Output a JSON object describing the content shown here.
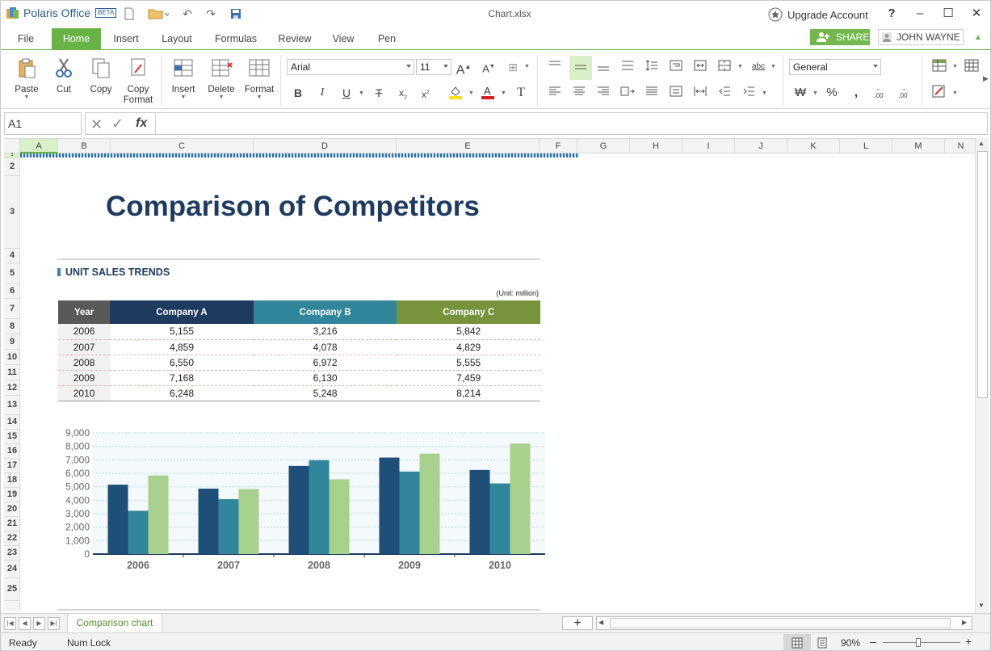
{
  "app": {
    "name": "Polaris Office",
    "badge": "BETA",
    "document_title": "Chart.xlsx",
    "upgrade_label": "Upgrade Account"
  },
  "menu": {
    "tabs": [
      "File",
      "Home",
      "Insert",
      "Layout",
      "Formulas",
      "Review",
      "View",
      "Pen"
    ],
    "active": "Home",
    "share_label": "SHARE",
    "user_name": "JOHN WAYNE"
  },
  "ribbon": {
    "clipboard": {
      "paste": "Paste",
      "cut": "Cut",
      "copy": "Copy",
      "copy_format": "Copy Format"
    },
    "cells": {
      "insert": "Insert",
      "delete": "Delete",
      "format": "Format"
    },
    "font_name": "Arial",
    "font_size": "11",
    "number_format": "General"
  },
  "formula_bar": {
    "cell_ref": "A1",
    "fx_label": "fx",
    "value": ""
  },
  "grid": {
    "columns": [
      "A",
      "B",
      "C",
      "D",
      "E",
      "F",
      "G",
      "H",
      "I",
      "J",
      "K",
      "L",
      "M",
      "N"
    ],
    "rows": [
      "1",
      "2",
      "3",
      "4",
      "5",
      "6",
      "7",
      "8",
      "9",
      "10",
      "11",
      "12",
      "13",
      "14",
      "15",
      "16",
      "17",
      "18",
      "19",
      "20",
      "21",
      "22",
      "23",
      "24",
      "25"
    ]
  },
  "sheet": {
    "title": "Comparison of Competitors",
    "section_label": "UNIT SALES TRENDS",
    "unit_note": "(Unit: million)",
    "table": {
      "headers": [
        "Year",
        "Company A",
        "Company B",
        "Company C"
      ],
      "header_colors": [
        "#595959",
        "#1f3a5f",
        "#31869b",
        "#77933c"
      ],
      "rows": [
        [
          "2006",
          "5,155",
          "3,216",
          "5,842"
        ],
        [
          "2007",
          "4,859",
          "4,078",
          "4,829"
        ],
        [
          "2008",
          "6,550",
          "6,972",
          "5,555"
        ],
        [
          "2009",
          "7,168",
          "6,130",
          "7,459"
        ],
        [
          "2010",
          "6,248",
          "5,248",
          "8,214"
        ]
      ]
    }
  },
  "chart_data": {
    "type": "bar",
    "title": "",
    "xlabel": "",
    "ylabel": "",
    "categories": [
      "2006",
      "2007",
      "2008",
      "2009",
      "2010"
    ],
    "series": [
      {
        "values": [
          5155,
          4859,
          6550,
          7168,
          6248
        ],
        "color": "#1f4e79"
      },
      {
        "values": [
          3216,
          4078,
          6972,
          6130,
          5248
        ],
        "color": "#31869b"
      },
      {
        "values": [
          5842,
          4829,
          5555,
          7459,
          8214
        ],
        "color": "#a9d18e"
      }
    ],
    "ylim": [
      0,
      9000
    ],
    "yticks": [
      "0",
      "1,000",
      "2,000",
      "3,000",
      "4,000",
      "5,000",
      "6,000",
      "7,000",
      "8,000",
      "9,000"
    ],
    "grid": true,
    "legend": "none"
  },
  "sheet_tabs": [
    "Comparison chart"
  ],
  "status": {
    "ready": "Ready",
    "numlock": "Num Lock",
    "zoom": "90%"
  },
  "colors": {
    "accent": "#67b346",
    "title": "#1f3a5f"
  }
}
